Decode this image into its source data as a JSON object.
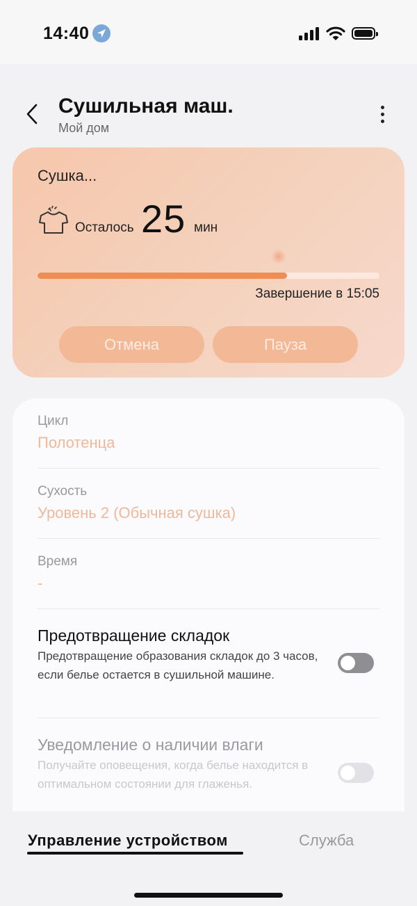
{
  "status_bar": {
    "time": "14:40"
  },
  "header": {
    "title": "Сушильная маш.",
    "subtitle": "Мой дом"
  },
  "status_card": {
    "state": "Сушка...",
    "remaining_label": "Осталось",
    "remaining_value": "25",
    "remaining_unit": "мин",
    "progress_fraction": 0.73,
    "finish_label": "Завершение в 15:05",
    "cancel_label": "Отмена",
    "pause_label": "Пауза"
  },
  "settings": {
    "cycle": {
      "label": "Цикл",
      "value": "Полотенца"
    },
    "dryness": {
      "label": "Сухость",
      "value": "Уровень 2 (Обычная сушка)"
    },
    "time": {
      "label": "Время",
      "value": "-"
    },
    "wrinkle": {
      "title": "Предотвращение складок",
      "description": "Предотвращение образования складок до 3 часов, если белье остается в сушильной машине.",
      "enabled": false
    },
    "moisture": {
      "title": "Уведомление о наличии влаги",
      "description": "Получайте оповещения, когда белье находится в оптимальном состоянии для глаженья.",
      "enabled": false
    }
  },
  "tabs": {
    "control": "Управление устройством",
    "service": "Служба"
  },
  "colors": {
    "accent": "#ee8e55",
    "card_bg": "#f6c7ac",
    "setting_value": "#eeb899",
    "toggle_active_off": "#8e8e93",
    "toggle_disabled_off": "#e2e2e6"
  }
}
